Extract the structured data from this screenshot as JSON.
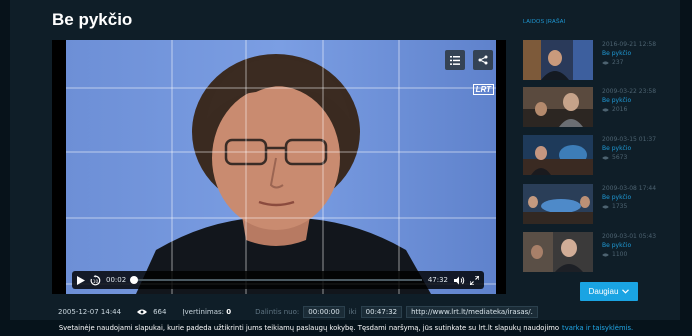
{
  "page": {
    "title": "Be pykčio"
  },
  "player": {
    "logo": "LRT",
    "current_time": "00:02",
    "duration": "47:32",
    "progress_fraction": 0.005
  },
  "meta": {
    "date": "2005-12-07 14:44",
    "views": "664",
    "rating_label": "Įvertinimas:",
    "rating_value": "0",
    "share_label": "Dalintis nuo:",
    "share_from": "00:00:00",
    "share_to_label": "iki",
    "share_to": "00:47:32",
    "share_url": "http://www.lrt.lt/mediateka/irasas/."
  },
  "sidebar": {
    "title": "LAIDOS ĮRAŠAI",
    "episodes": [
      {
        "date": "2016-09-21 12:58",
        "name": "Be pykčio",
        "views": "237"
      },
      {
        "date": "2009-03-22 23:58",
        "name": "Be pykčio",
        "views": "2016"
      },
      {
        "date": "2009-03-15 01:37",
        "name": "Be pykčio",
        "views": "5673"
      },
      {
        "date": "2009-03-08 17:44",
        "name": "Be pykčio",
        "views": "1735"
      },
      {
        "date": "2009-03-01 05:43",
        "name": "Be pykčio",
        "views": "1100"
      }
    ],
    "more_label": "Daugiau"
  },
  "cookie": {
    "text": "Svetainėje naudojami slapukai, kurie padeda užtikrinti jums teikiamų paslaugų kokybę. Tęsdami naršymą, jūs sutinkate su lrt.lt slapukų naudojimo",
    "link": "tvarka ir taisyklėmis."
  },
  "colors": {
    "accent": "#1aa4e3",
    "background": "#0f1e28",
    "link": "#1f9ad6"
  },
  "icons": [
    "list-icon",
    "share-icon",
    "play-icon",
    "replay-10-icon",
    "volume-icon",
    "fullscreen-icon",
    "eye-icon",
    "chevron-down-icon"
  ]
}
